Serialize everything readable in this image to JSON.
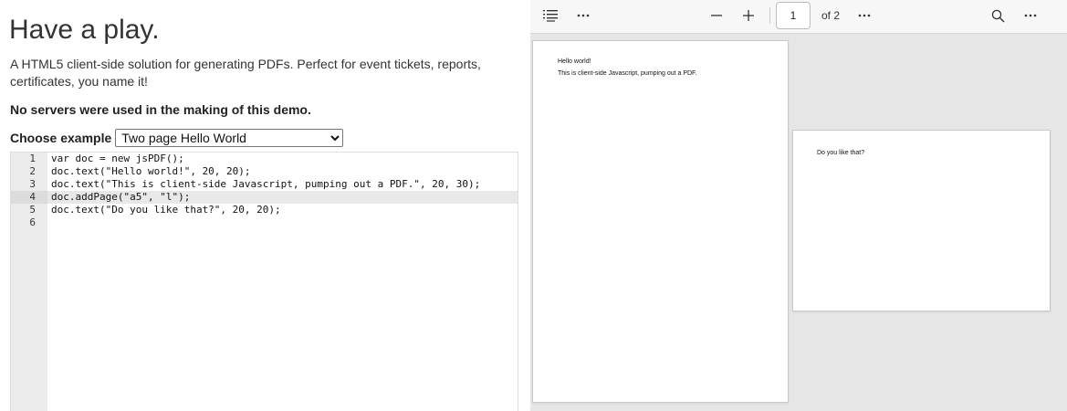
{
  "left_panel": {
    "heading": "Have a play.",
    "intro": "A HTML5 client-side solution for generating PDFs. Perfect for event tickets, reports, certificates, you name it!",
    "no_servers": "No servers were used in the making of this demo.",
    "choose_label": "Choose example",
    "selected_example": "Two page Hello World"
  },
  "editor": {
    "lines": [
      {
        "number": "1",
        "code": "var doc = new jsPDF();"
      },
      {
        "number": "2",
        "code": "doc.text(\"Hello world!\", 20, 20);"
      },
      {
        "number": "3",
        "code": "doc.text(\"This is client-side Javascript, pumping out a PDF.\", 20, 30);"
      },
      {
        "number": "4",
        "code": "doc.addPage(\"a5\", \"l\");"
      },
      {
        "number": "5",
        "code": "doc.text(\"Do you like that?\", 20, 20);"
      },
      {
        "number": "6",
        "code": ""
      }
    ],
    "active_line": "4"
  },
  "viewer": {
    "toolbar": {
      "outline_icon": "list-icon",
      "more_icon": "more-horizontal-icon",
      "zoom_out_icon": "minus-icon",
      "zoom_in_icon": "plus-icon",
      "current_page": "1",
      "page_count": "of 2",
      "search_icon": "search-icon"
    },
    "pages": [
      {
        "lines": [
          "Hello world!",
          "This is client-side Javascript, pumping out a PDF."
        ]
      },
      {
        "lines": [
          "Do you like that?"
        ]
      }
    ]
  }
}
